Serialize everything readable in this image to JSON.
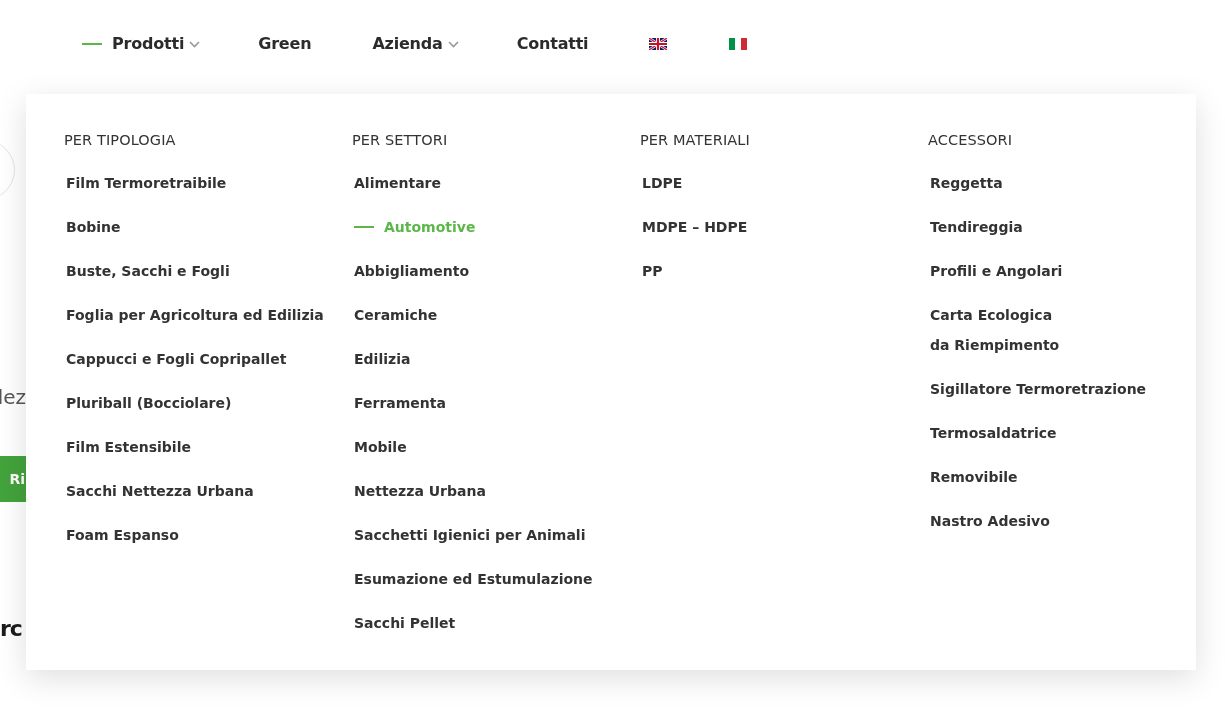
{
  "nav": [
    {
      "kind": "link",
      "label": "Prodotti",
      "selected": true,
      "dropdown": true
    },
    {
      "kind": "link",
      "label": "Green",
      "selected": false,
      "dropdown": false
    },
    {
      "kind": "link",
      "label": "Azienda",
      "selected": false,
      "dropdown": true
    },
    {
      "kind": "link",
      "label": "Contatti",
      "selected": false,
      "dropdown": false
    },
    {
      "kind": "english"
    },
    {
      "kind": "italian"
    }
  ],
  "background": {
    "text": "lez",
    "button": "Ri",
    "heading": "rc"
  },
  "mega_menu": {
    "columns": [
      {
        "heading": "PER TIPOLOGIA",
        "items": [
          {
            "label": "Film Termoretraibile",
            "selected": false
          },
          {
            "label": "Bobine",
            "selected": false
          },
          {
            "label": "Buste, Sacchi e Fogli",
            "selected": false
          },
          {
            "label": "Foglia per Agricoltura ed Edilizia",
            "selected": false
          },
          {
            "label": "Cappucci e Fogli Copripallet",
            "selected": false
          },
          {
            "label": "Pluriball (Bocciolare)",
            "selected": false
          },
          {
            "label": "Film Estensibile",
            "selected": false
          },
          {
            "label": "Sacchi Nettezza Urbana",
            "selected": false
          },
          {
            "label": "Foam Espanso",
            "selected": false
          }
        ]
      },
      {
        "heading": "PER SETTORI",
        "items": [
          {
            "label": "Alimentare",
            "selected": false
          },
          {
            "label": "Automotive",
            "selected": true
          },
          {
            "label": "Abbigliamento",
            "selected": false
          },
          {
            "label": "Ceramiche",
            "selected": false
          },
          {
            "label": "Edilizia",
            "selected": false
          },
          {
            "label": "Ferramenta",
            "selected": false
          },
          {
            "label": "Mobile",
            "selected": false
          },
          {
            "label": "Nettezza Urbana",
            "selected": false
          },
          {
            "label": "Sacchetti Igienici per Animali",
            "selected": false
          },
          {
            "label": "Esumazione ed Estumulazione",
            "selected": false
          },
          {
            "label": "Sacchi Pellet",
            "selected": false
          }
        ]
      },
      {
        "heading": "PER MATERIALI",
        "items": [
          {
            "label": "LDPE",
            "selected": false
          },
          {
            "label": "MDPE – HDPE",
            "selected": false
          },
          {
            "label": "PP",
            "selected": false
          }
        ]
      },
      {
        "heading": "ACCESSORI",
        "items": [
          {
            "label": "Reggetta",
            "selected": false
          },
          {
            "label": "Tendireggia",
            "selected": false
          },
          {
            "label": "Profili e Angolari",
            "selected": false
          },
          {
            "label": "Carta Ecologica\nda Riempimento",
            "selected": false
          },
          {
            "label": "Sigillatore Termoretrazione",
            "selected": false
          },
          {
            "label": "Termosaldatrice",
            "selected": false
          },
          {
            "label": "Removibile",
            "selected": false
          },
          {
            "label": "Nastro Adesivo",
            "selected": false
          }
        ]
      }
    ]
  }
}
